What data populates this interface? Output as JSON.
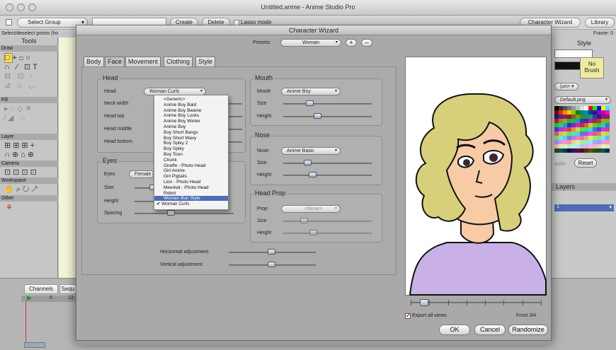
{
  "window": {
    "title": "Untitled.anme - Anime Studio Pro"
  },
  "toolbar": {
    "select_group": "Select Group",
    "create": "Create",
    "delete": "Delete",
    "lasso": "Lasso mode",
    "character_wizard": "Character Wizard",
    "library": "Library"
  },
  "status": {
    "text": "Select/deselect points (ho",
    "frame": "Frame: 0"
  },
  "left_panel": {
    "title": "Tools",
    "sections": [
      "Draw",
      "Fill",
      "Layer",
      "Camera",
      "Workspace",
      "Other"
    ]
  },
  "right_panel": {
    "style_title": "Style",
    "no_brush": "No\nBrush",
    "popup_none": "(un> ▾",
    "default_png": "Default.png",
    "reset": "Reset",
    "paste": "aste",
    "layers_title": "Layers",
    "layer_row": "1"
  },
  "bottom_panel": {
    "channels": "Channels",
    "sequencer": "Sequ",
    "frame_6": "6",
    "frame_12": "12"
  },
  "dialog": {
    "title": "Character Wizard",
    "presets_label": "Presets:",
    "presets_value": "Woman",
    "plus": "+",
    "minus": "–",
    "tabs": [
      "Body",
      "Face",
      "Movement",
      "Clothing",
      "Style"
    ],
    "head": {
      "title": "Head",
      "rows": [
        "Head",
        "Neck width",
        "Head top",
        "Head middle",
        "Head bottom"
      ],
      "head_value": "Woman Curls"
    },
    "eyes": {
      "title": "Eyes",
      "rows": [
        "Eyes",
        "Size",
        "Height",
        "Spacing"
      ],
      "eyes_value": "Female A"
    },
    "mouth": {
      "title": "Mouth",
      "rows": [
        "Mouth",
        "Size",
        "Height"
      ],
      "value": "Anime Boy"
    },
    "nose": {
      "title": "Nose",
      "rows": [
        "Nose",
        "Size",
        "Height"
      ],
      "value": "Anime Basic"
    },
    "head_prop": {
      "title": "Head Prop",
      "rows": [
        "Prop",
        "Size",
        "Height"
      ],
      "value": "<None>"
    },
    "horizontal_adjustment": "Horizontal adjustment:",
    "vertical_adjustment": "Vertical adjustment:",
    "dropdown_items": [
      "<Generic>",
      "Anime Boy Bald",
      "Anime Boy Beanie",
      "Anime Boy Locks",
      "Anime Boy Winter",
      "Anime Boy",
      "Boy Short Bangs",
      "Boy Short Wavy",
      "Boy Spiky 2",
      "Boy Spiky",
      "Boy Toon",
      "Chunk",
      "Giraffe - Photo Head",
      "Girl Anime",
      "Girl Pigtails",
      "Lion - Photo Head",
      "Meerkat - Photo Head",
      "Robot",
      "Woman Bun Style",
      "Woman Curls"
    ],
    "dropdown_highlighted": "Woman Bun Style",
    "dropdown_checked": "Woman Curls",
    "export_all_views": "Export all views",
    "view_label": "Front 3/4",
    "ok": "OK",
    "cancel": "Cancel",
    "randomize": "Randomize"
  },
  "colors": {
    "hair": "#d8cf7a",
    "skin": "#f7cba6",
    "shirt": "#c9b0e6",
    "highlight": "#4e6bb8"
  }
}
